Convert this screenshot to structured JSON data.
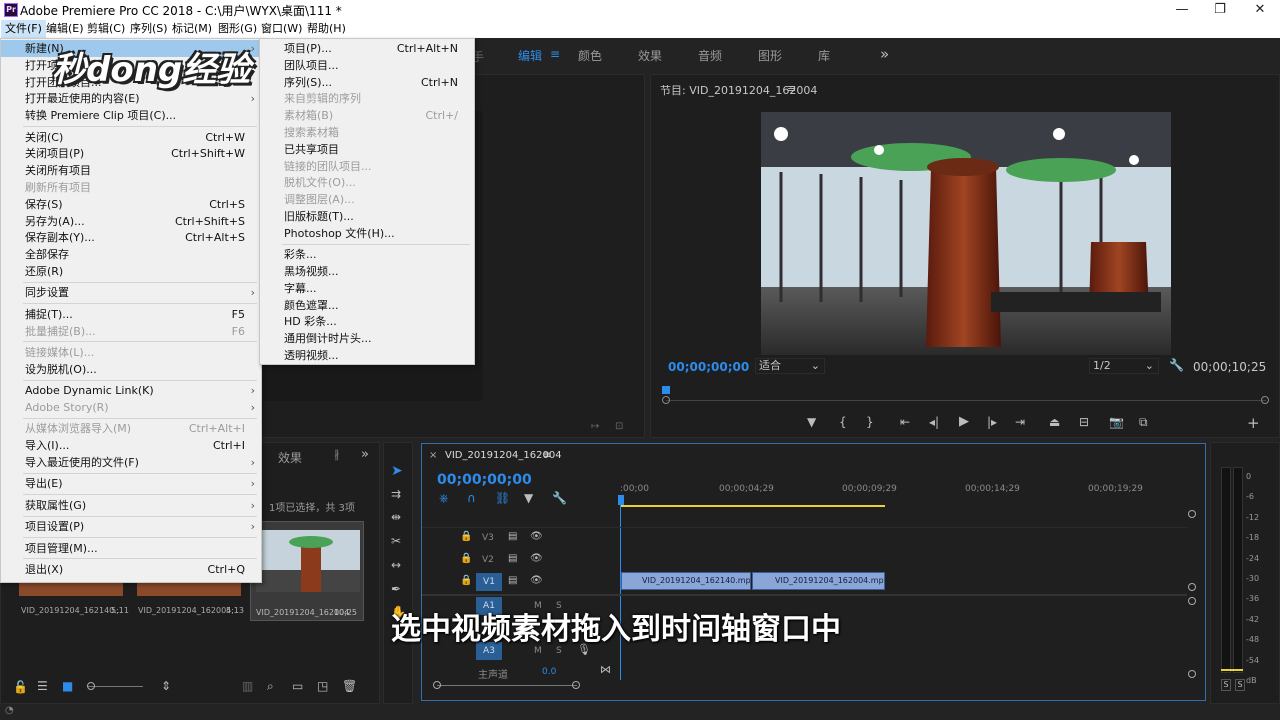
{
  "window": {
    "title": "Adobe Premiere Pro CC 2018 - C:\\用户\\WYX\\桌面\\111 *",
    "app_icon": "Pr",
    "minimize": "—",
    "maximize": "❐",
    "close": "✕"
  },
  "menubar": [
    "文件(F)",
    "编辑(E)",
    "剪辑(C)",
    "序列(S)",
    "标记(M)",
    "图形(G)",
    "窗口(W)",
    "帮助(H)"
  ],
  "workspaces": {
    "tab_1": "编辑",
    "tab_2": "颜色",
    "tab_3": "效果",
    "tab_4": "音频",
    "tab_5": "图形",
    "tab_6": "库",
    "more": "»"
  },
  "watermark": "秒dong经验",
  "file_menu": [
    {
      "label": "新建(N)",
      "submenu": true,
      "highlight": true
    },
    {
      "label": "打开项目(O)...",
      "shortcut": "Ctrl+O"
    },
    {
      "label": "打开团队项目..."
    },
    {
      "label": "打开最近使用的内容(E)",
      "submenu": true
    },
    {
      "label": "转换 Premiere Clip 项目(C)..."
    },
    {
      "sep": true
    },
    {
      "label": "关闭(C)",
      "shortcut": "Ctrl+W"
    },
    {
      "label": "关闭项目(P)",
      "shortcut": "Ctrl+Shift+W"
    },
    {
      "label": "关闭所有项目"
    },
    {
      "label": "刷新所有项目",
      "disabled": true
    },
    {
      "label": "保存(S)",
      "shortcut": "Ctrl+S"
    },
    {
      "label": "另存为(A)...",
      "shortcut": "Ctrl+Shift+S"
    },
    {
      "label": "保存副本(Y)...",
      "shortcut": "Ctrl+Alt+S"
    },
    {
      "label": "全部保存"
    },
    {
      "label": "还原(R)"
    },
    {
      "sep": true
    },
    {
      "label": "同步设置",
      "submenu": true
    },
    {
      "sep": true
    },
    {
      "label": "捕捉(T)...",
      "shortcut": "F5"
    },
    {
      "label": "批量捕捉(B)...",
      "shortcut": "F6",
      "disabled": true
    },
    {
      "sep": true
    },
    {
      "label": "链接媒体(L)...",
      "disabled": true
    },
    {
      "label": "设为脱机(O)..."
    },
    {
      "sep": true
    },
    {
      "label": "Adobe Dynamic Link(K)",
      "submenu": true
    },
    {
      "label": "Adobe Story(R)",
      "submenu": true,
      "disabled": true
    },
    {
      "sep": true
    },
    {
      "label": "从媒体浏览器导入(M)",
      "shortcut": "Ctrl+Alt+I",
      "disabled": true
    },
    {
      "label": "导入(I)...",
      "shortcut": "Ctrl+I"
    },
    {
      "label": "导入最近使用的文件(F)",
      "submenu": true
    },
    {
      "sep": true
    },
    {
      "label": "导出(E)",
      "submenu": true
    },
    {
      "sep": true
    },
    {
      "label": "获取属性(G)",
      "submenu": true
    },
    {
      "sep": true
    },
    {
      "label": "项目设置(P)",
      "submenu": true
    },
    {
      "sep": true
    },
    {
      "label": "项目管理(M)..."
    },
    {
      "sep": true
    },
    {
      "label": "退出(X)",
      "shortcut": "Ctrl+Q"
    }
  ],
  "new_submenu": [
    {
      "label": "项目(P)...",
      "shortcut": "Ctrl+Alt+N"
    },
    {
      "label": "团队项目..."
    },
    {
      "label": "序列(S)...",
      "shortcut": "Ctrl+N"
    },
    {
      "label": "来自剪辑的序列",
      "disabled": true
    },
    {
      "label": "素材箱(B)",
      "shortcut": "Ctrl+/",
      "disabled": true
    },
    {
      "label": "搜索素材箱",
      "disabled": true
    },
    {
      "label": "已共享项目"
    },
    {
      "label": "链接的团队项目...",
      "disabled": true
    },
    {
      "label": "脱机文件(O)...",
      "disabled": true
    },
    {
      "label": "调整图层(A)...",
      "disabled": true
    },
    {
      "label": "旧版标题(T)..."
    },
    {
      "label": "Photoshop 文件(H)..."
    },
    {
      "sep": true
    },
    {
      "label": "彩条..."
    },
    {
      "label": "黑场视频..."
    },
    {
      "label": "字幕..."
    },
    {
      "label": "颜色遮罩..."
    },
    {
      "label": "HD 彩条..."
    },
    {
      "label": "通用倒计时片头..."
    },
    {
      "label": "透明视频..."
    }
  ],
  "program_monitor": {
    "title": "节目: VID_20191204_162004",
    "menu": "≡",
    "timecode": "00;00;00;00",
    "fit": "适合",
    "resolution": "1/2",
    "duration": "00;00;10;25"
  },
  "project_panel": {
    "tab_effects": "效果",
    "status": "1项已选择，共 3项",
    "items": [
      {
        "name": "VID_20191204_162140...",
        "duration": "5;11"
      },
      {
        "name": "VID_20191204_162004...",
        "duration": "5;13"
      },
      {
        "name": "VID_20191204_162004",
        "duration": "10;25"
      }
    ]
  },
  "timeline": {
    "close": "×",
    "title": "VID_20191204_162004",
    "menu": "≡",
    "timecode": "00;00;00;00",
    "ruler": [
      ":00;00",
      "00;00;04;29",
      "00;00;09;29",
      "00;00;14;29",
      "00;00;19;29"
    ],
    "tracks": {
      "v3": "V3",
      "v2": "V2",
      "v1": "V1",
      "a1": "A1",
      "a3": "A3",
      "master": "主声道",
      "master_value": "0.0",
      "m": "M",
      "s": "S"
    },
    "clips": {
      "clip1": "VID_20191204_162140.mp4",
      "clip2": "VID_20191204_162004.mp4"
    }
  },
  "audio_meter": {
    "scale": [
      "0",
      "-6",
      "-12",
      "-18",
      "-24",
      "-30",
      "-36",
      "-42",
      "-48",
      "-54",
      "dB"
    ],
    "solo_l": "S",
    "solo_r": "S"
  },
  "subtitle": "选中视频素材拖入到时间轴窗口中",
  "colors": {
    "accent": "#2d8ceb",
    "menu_bg": "#f0f0f0",
    "menu_highlight": "#9ec9ec",
    "clip": "#8aa6d6",
    "timeline_yellow": "#e8d232"
  }
}
